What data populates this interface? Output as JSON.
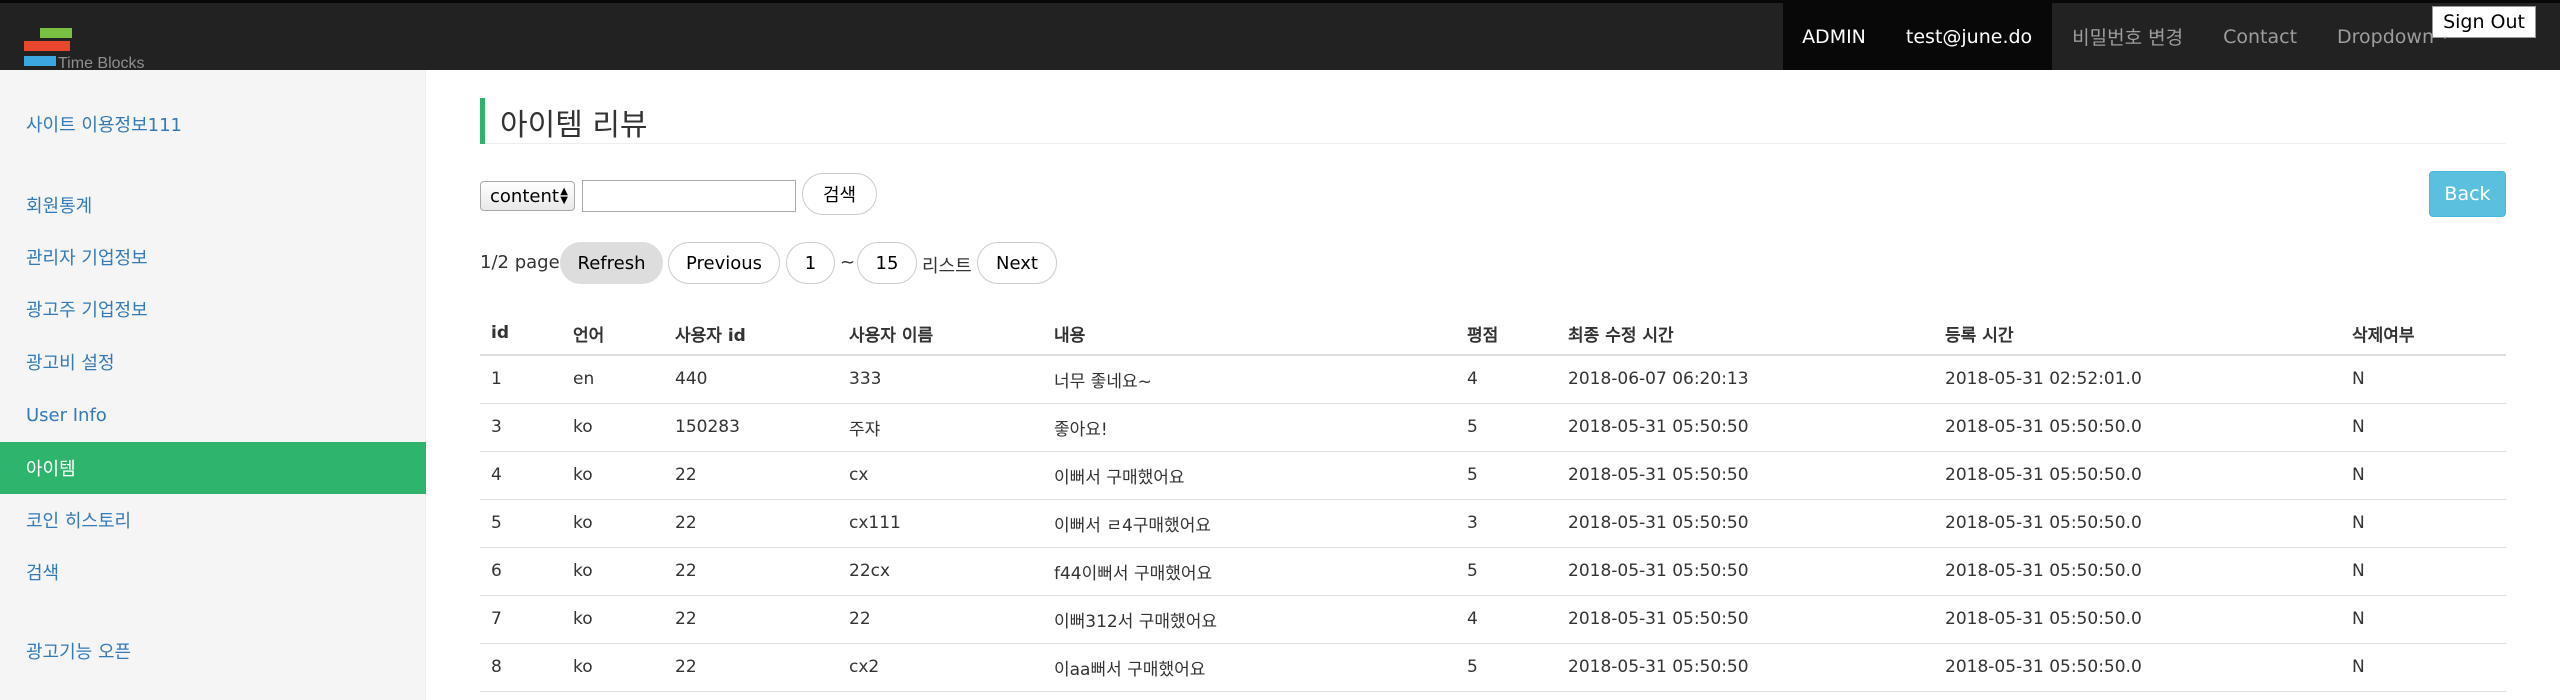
{
  "navbar": {
    "brand_text": "Time Blocks",
    "items": [
      {
        "label": "ADMIN"
      },
      {
        "label": "test@june.do"
      },
      {
        "label": "비밀번호 변경"
      },
      {
        "label": "Contact"
      },
      {
        "label": "Dropdown"
      }
    ],
    "sign_out_label": "Sign Out"
  },
  "sidebar": {
    "items": [
      {
        "label": "사이트 이용정보111",
        "active": false
      },
      {
        "label": "회원통계",
        "active": false
      },
      {
        "label": "관리자 기업정보",
        "active": false
      },
      {
        "label": "광고주 기업정보",
        "active": false
      },
      {
        "label": "광고비 설정",
        "active": false
      },
      {
        "label": "User Info",
        "active": false
      },
      {
        "label": "아이템",
        "active": true
      },
      {
        "label": "코인 히스토리",
        "active": false
      },
      {
        "label": "검색",
        "active": false
      },
      {
        "label": "광고기능 오픈",
        "active": false
      }
    ]
  },
  "main": {
    "page_title": "아이템 리뷰",
    "search": {
      "select_value": "content",
      "input_value": "",
      "button_label": "검색"
    },
    "back_label": "Back",
    "pagination": {
      "page_info": "1/2 page",
      "refresh_label": "Refresh",
      "previous_label": "Previous",
      "from": "1",
      "separator": "~",
      "to": "15",
      "list_label": "리스트",
      "next_label": "Next"
    },
    "table": {
      "columns": [
        "id",
        "언어",
        "사용자 id",
        "사용자 이름",
        "내용",
        "평점",
        "최종 수정 시간",
        "등록 시간",
        "삭제여부"
      ],
      "rows": [
        [
          "1",
          "en",
          "440",
          "333",
          "너무 좋네요~",
          "4",
          "2018-06-07 06:20:13",
          "2018-05-31 02:52:01.0",
          "N"
        ],
        [
          "3",
          "ko",
          "150283",
          "주쟈",
          "좋아요!",
          "5",
          "2018-05-31 05:50:50",
          "2018-05-31 05:50:50.0",
          "N"
        ],
        [
          "4",
          "ko",
          "22",
          "cx",
          "이뻐서 구매했어요",
          "5",
          "2018-05-31 05:50:50",
          "2018-05-31 05:50:50.0",
          "N"
        ],
        [
          "5",
          "ko",
          "22",
          "cx111",
          "이뻐서 ㄹ4구매했어요",
          "3",
          "2018-05-31 05:50:50",
          "2018-05-31 05:50:50.0",
          "N"
        ],
        [
          "6",
          "ko",
          "22",
          "22cx",
          "f44이뻐서 구매했어요",
          "5",
          "2018-05-31 05:50:50",
          "2018-05-31 05:50:50.0",
          "N"
        ],
        [
          "7",
          "ko",
          "22",
          "22",
          "이뻐312서 구매했어요",
          "4",
          "2018-05-31 05:50:50",
          "2018-05-31 05:50:50.0",
          "N"
        ],
        [
          "8",
          "ko",
          "22",
          "cx2",
          "이aa뻐서 구매했어요",
          "5",
          "2018-05-31 05:50:50",
          "2018-05-31 05:50:50.0",
          "N"
        ]
      ]
    }
  },
  "colors": {
    "navbar_bg": "#222222",
    "accent_green": "#2fb46e",
    "back_button": "#5bc0de",
    "link_blue": "#337ab7"
  }
}
